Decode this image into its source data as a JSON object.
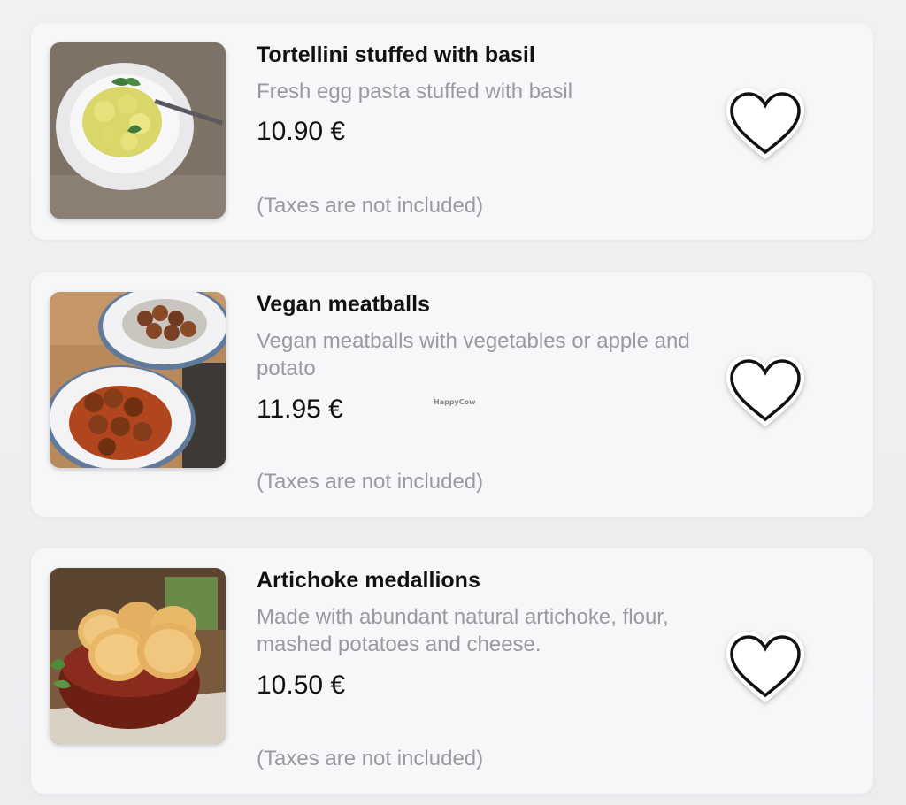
{
  "menu_items": [
    {
      "name": "Tortellini stuffed with basil",
      "description": "Fresh egg pasta stuffed with basil",
      "price": "10.90 €",
      "tax_note": "(Taxes are not included)",
      "favorite_icon": "heart-outline-icon"
    },
    {
      "name": "Vegan meatballs",
      "description": "Vegan meatballs with vegetables or apple and potato",
      "price": "11.95 €",
      "tax_note": "(Taxes are not included)",
      "favorite_icon": "heart-outline-icon"
    },
    {
      "name": "Artichoke medallions",
      "description": "Made with abundant natural artichoke, flour, mashed potatoes and cheese.",
      "price": "10.50 €",
      "tax_note": "(Taxes are not included)",
      "favorite_icon": "heart-outline-icon"
    }
  ],
  "watermark": "HappyCow",
  "colors": {
    "card_background": "#f6f7f9",
    "title_text": "#111111",
    "secondary_text": "#9a9a9e"
  }
}
